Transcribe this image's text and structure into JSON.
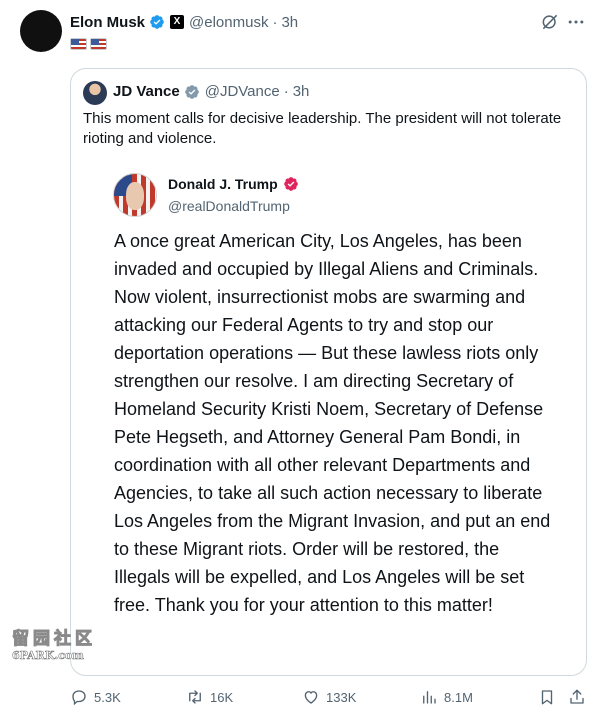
{
  "author": {
    "name": "Elon Musk",
    "badge": "X",
    "handle": "@elonmusk",
    "time": "3h"
  },
  "quote": {
    "author": {
      "name": "JD Vance",
      "handle": "@JDVance",
      "time": "3h"
    },
    "text": "This moment calls for decisive leadership. The president will not tolerate rioting and violence.",
    "image_post": {
      "name": "Donald J. Trump",
      "handle": "@realDonaldTrump",
      "body": "A once great American City, Los Angeles, has been invaded and occupied by Illegal Aliens and Criminals.  Now violent, insurrectionist mobs are swarming and attacking our Federal Agents to try and stop our deportation operations — But these lawless riots only strengthen our resolve. I am directing Secretary of Homeland Security Kristi Noem, Secretary of Defense Pete Hegseth, and Attorney General Pam Bondi, in coordination with all other relevant Departments and Agencies, to take all such action necessary to liberate Los Angeles from the Migrant Invasion, and put an end to these Migrant riots. Order will be restored, the Illegals will be expelled, and Los Angeles will be set free. Thank you for your attention to this matter!"
    }
  },
  "watermark": {
    "chinese": "留园社区",
    "english": "6PARK.com"
  },
  "actions": {
    "replies": "5.3K",
    "reposts": "16K",
    "likes": "133K",
    "views": "8.1M"
  },
  "colors": {
    "verified_blue": "#1d9bf0",
    "verified_gray": "#829aab",
    "verified_pink": "#e0245e",
    "secondary_text": "#536471",
    "border": "#cfd9de"
  },
  "icons": [
    "grok-icon",
    "more-icon",
    "reply-icon",
    "repost-icon",
    "like-icon",
    "views-icon",
    "bookmark-icon",
    "share-icon"
  ]
}
